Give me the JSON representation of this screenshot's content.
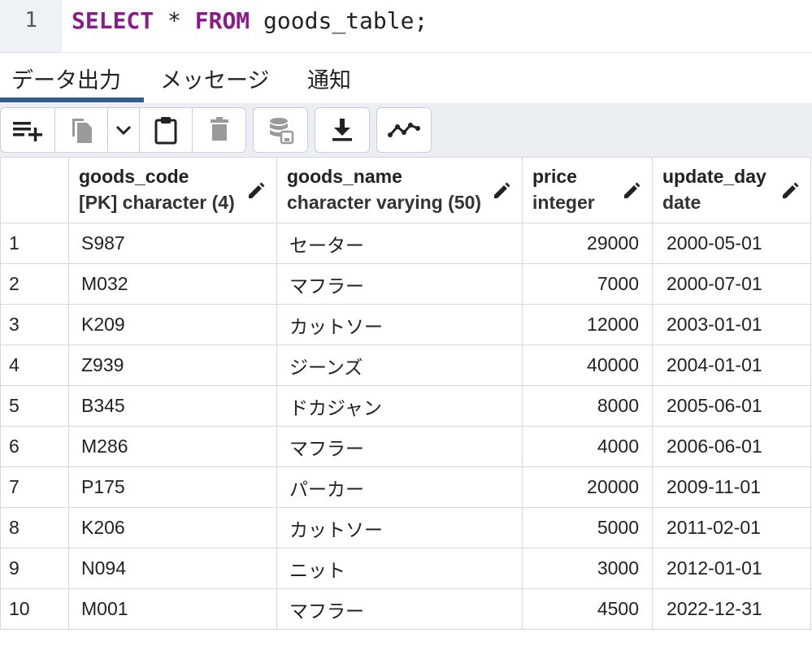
{
  "editor": {
    "line_number": "1",
    "kw_select": "SELECT",
    "star": " * ",
    "kw_from": "FROM",
    "rest": " goods_table;"
  },
  "tabs": [
    "データ出力",
    "メッセージ",
    "通知"
  ],
  "toolbar": {
    "icons": [
      "add-row-icon",
      "copy-icon",
      "chevron-down-icon",
      "paste-icon",
      "delete-icon",
      "save-data-icon",
      "download-icon",
      "graph-icon"
    ]
  },
  "columns": [
    {
      "name": "goods_code",
      "type": "[PK] character (4)"
    },
    {
      "name": "goods_name",
      "type": "character varying (50)"
    },
    {
      "name": "price",
      "type": "integer"
    },
    {
      "name": "update_day",
      "type": "date"
    }
  ],
  "rows": [
    {
      "n": "1",
      "code": "S987",
      "name": "セーター",
      "price": "29000",
      "date": "2000-05-01"
    },
    {
      "n": "2",
      "code": "M032",
      "name": "マフラー",
      "price": "7000",
      "date": "2000-07-01"
    },
    {
      "n": "3",
      "code": "K209",
      "name": "カットソー",
      "price": "12000",
      "date": "2003-01-01"
    },
    {
      "n": "4",
      "code": "Z939",
      "name": "ジーンズ",
      "price": "40000",
      "date": "2004-01-01"
    },
    {
      "n": "5",
      "code": "B345",
      "name": "ドカジャン",
      "price": "8000",
      "date": "2005-06-01"
    },
    {
      "n": "6",
      "code": "M286",
      "name": "マフラー",
      "price": "4000",
      "date": "2006-06-01"
    },
    {
      "n": "7",
      "code": "P175",
      "name": "パーカー",
      "price": "20000",
      "date": "2009-11-01"
    },
    {
      "n": "8",
      "code": "K206",
      "name": "カットソー",
      "price": "5000",
      "date": "2011-02-01"
    },
    {
      "n": "9",
      "code": "N094",
      "name": "ニット",
      "price": "3000",
      "date": "2012-01-01"
    },
    {
      "n": "10",
      "code": "M001",
      "name": "マフラー",
      "price": "4500",
      "date": "2022-12-31"
    }
  ]
}
